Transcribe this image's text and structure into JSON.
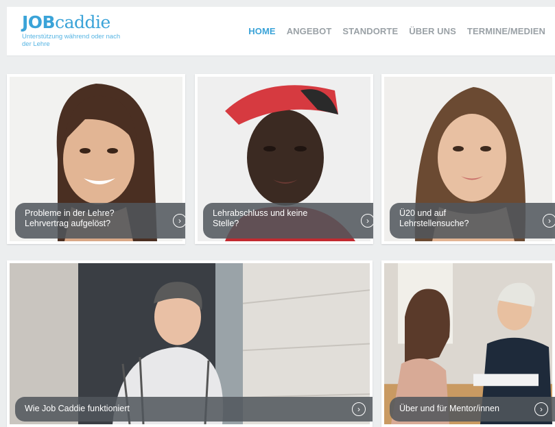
{
  "header": {
    "logo_bold": "JOB",
    "logo_rest": "caddie",
    "tagline": "Unterstützung während oder nach der Lehre",
    "brand_color": "#3aa3d8"
  },
  "nav": {
    "items": [
      {
        "label": "HOME",
        "active": true
      },
      {
        "label": "ANGEBOT",
        "active": false
      },
      {
        "label": "STANDORTE",
        "active": false
      },
      {
        "label": "ÜBER UNS",
        "active": false
      },
      {
        "label": "TERMINE/MEDIEN",
        "active": false
      }
    ]
  },
  "tiles": [
    {
      "line1": "Probleme in der Lehre?",
      "line2": "Lehrvertrag aufgelöst?"
    },
    {
      "line1": "Lehrabschluss und keine",
      "line2": "Stelle?"
    },
    {
      "line1": "Ü20 und auf",
      "line2": "Lehrstellensuche?"
    },
    {
      "line1": "Wie Job Caddie funktioniert"
    },
    {
      "line1": "Über und für Mentor/innen"
    }
  ],
  "icons": {
    "arrow": "chevron-right-circle-icon"
  }
}
